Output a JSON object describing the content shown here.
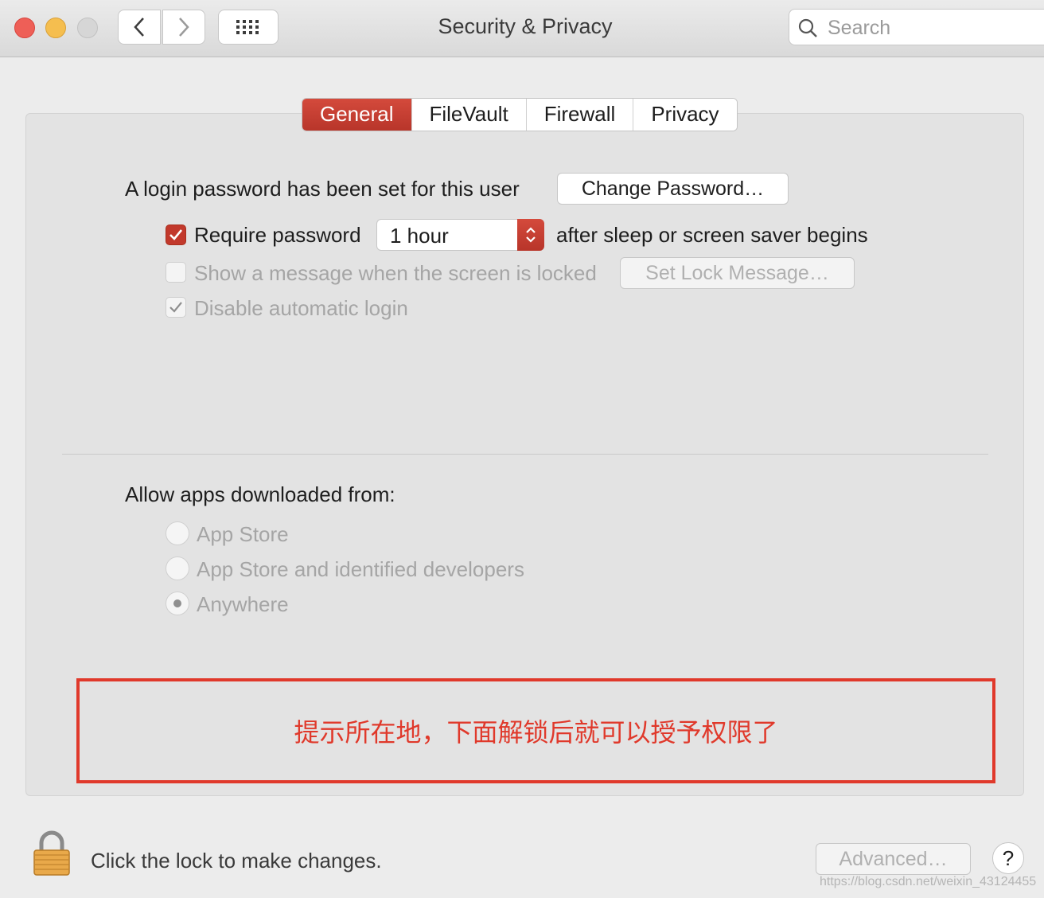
{
  "window": {
    "title": "Security & Privacy"
  },
  "toolbar": {
    "search_placeholder": "Search"
  },
  "tabs": [
    {
      "label": "General",
      "active": true
    },
    {
      "label": "FileVault",
      "active": false
    },
    {
      "label": "Firewall",
      "active": false
    },
    {
      "label": "Privacy",
      "active": false
    }
  ],
  "general": {
    "login_password_text": "A login password has been set for this user",
    "change_password_button": "Change Password…",
    "require_password_label": "Require password",
    "require_password_checked": true,
    "require_password_delay": "1 hour",
    "require_password_suffix": "after sleep or screen saver begins",
    "show_message_label": "Show a message when the screen is locked",
    "show_message_checked": false,
    "set_lock_message_button": "Set Lock Message…",
    "disable_auto_login_label": "Disable automatic login",
    "disable_auto_login_checked": true
  },
  "downloads": {
    "heading": "Allow apps downloaded from:",
    "options": [
      {
        "label": "App Store",
        "selected": false
      },
      {
        "label": "App Store and identified developers",
        "selected": false
      },
      {
        "label": "Anywhere",
        "selected": true
      }
    ]
  },
  "annotation": {
    "text": "提示所在地，下面解锁后就可以授予权限了",
    "color": "#e0392b"
  },
  "footer": {
    "lock_text": "Click the lock to make changes.",
    "advanced_button": "Advanced…",
    "help_label": "?"
  },
  "watermark": "https://blog.csdn.net/weixin_43124455",
  "colors": {
    "accent": "#c2392c"
  }
}
